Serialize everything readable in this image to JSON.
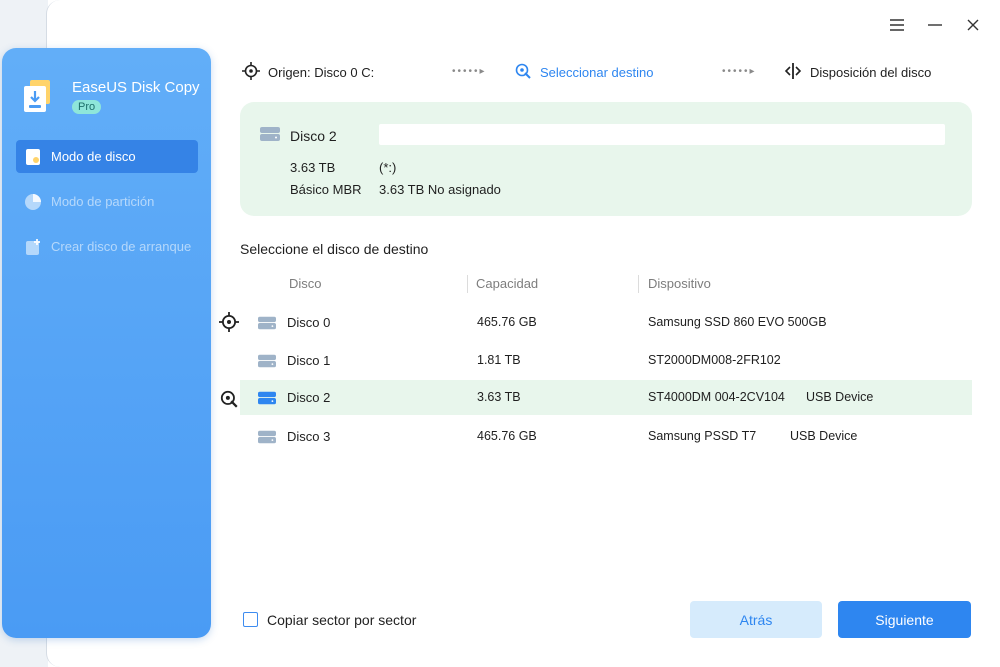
{
  "colors": {
    "accent": "#2e86f0",
    "sidebar": "#4a9bf4",
    "selected_bg": "#e8f6ec"
  },
  "window": {
    "controls": [
      "menu-icon",
      "minimize-icon",
      "close-icon"
    ]
  },
  "app": {
    "name": "EaseUS Disk Copy",
    "edition": "Pro"
  },
  "sidebar": {
    "items": [
      {
        "label": "Modo de disco",
        "icon": "disk-mode-icon"
      },
      {
        "label": "Modo de partición",
        "icon": "partition-mode-icon"
      },
      {
        "label": "Crear disco de arranque",
        "icon": "bootable-disk-icon"
      }
    ]
  },
  "steps": [
    {
      "label": "Origen: Disco 0 C:",
      "icon": "crosshair-icon"
    },
    {
      "label": "Seleccionar destino",
      "icon": "target-select-icon"
    },
    {
      "label": "Disposición del disco",
      "icon": "layout-icon"
    }
  ],
  "selected_disk": {
    "name": "Disco 2",
    "size": "3.63 TB",
    "partition": "(*:)",
    "type": "Básico MBR",
    "unallocated": "3.63 TB No asignado"
  },
  "table": {
    "title": "Seleccione el disco de destino",
    "columns": [
      "Disco",
      "Capacidad",
      "Dispositivo"
    ],
    "rows": [
      {
        "disk": "Disco 0",
        "capacity": "465.76 GB",
        "device": "Samsung SSD 860 EVO 500GB",
        "extra": ""
      },
      {
        "disk": "Disco 1",
        "capacity": "1.81 TB",
        "device": "ST2000DM008-2FR102",
        "extra": ""
      },
      {
        "disk": "Disco 2",
        "capacity": "3.63 TB",
        "device": "ST4000DM 004-2CV104",
        "extra": "USB Device"
      },
      {
        "disk": "Disco 3",
        "capacity": "465.76 GB",
        "device": "Samsung  PSSD T7",
        "extra": "USB Device"
      }
    ]
  },
  "footer": {
    "copy_sector_label": "Copiar sector por sector",
    "back_label": "Atrás",
    "next_label": "Siguiente"
  }
}
